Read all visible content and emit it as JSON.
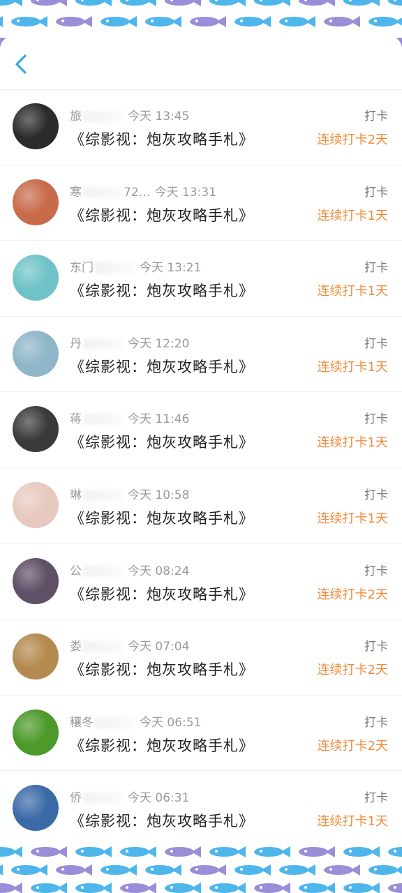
{
  "colors": {
    "accent_blue": "#3aa7e0",
    "streak_orange": "#f08a3a",
    "fish_blue": "#4fb6ec",
    "fish_purple": "#9b8ed8"
  },
  "header": {
    "back_icon": "chevron-left-icon"
  },
  "list": {
    "items": [
      {
        "user": "旅",
        "time": "今天 13:45",
        "book": "《综影视：炮灰攻略手札》",
        "action": "打卡",
        "streak": "连续打卡2天",
        "avatar_color": "#2b2b2b"
      },
      {
        "user": "寒",
        "time": "今天 13:31",
        "extra": "72…",
        "book": "《综影视：炮灰攻略手札》",
        "action": "打卡",
        "streak": "连续打卡1天",
        "avatar_color": "#c86b4b"
      },
      {
        "user": "东门",
        "time": "今天 13:21",
        "book": "《综影视：炮灰攻略手札》",
        "action": "打卡",
        "streak": "连续打卡1天",
        "avatar_color": "#6fc3c8"
      },
      {
        "user": "丹",
        "time": "今天 12:20",
        "book": "《综影视：炮灰攻略手札》",
        "action": "打卡",
        "streak": "连续打卡1天",
        "avatar_color": "#8fb6c9"
      },
      {
        "user": "蒋",
        "time": "今天 11:46",
        "book": "《综影视：炮灰攻略手札》",
        "action": "打卡",
        "streak": "连续打卡1天",
        "avatar_color": "#3a3a3a"
      },
      {
        "user": "琳",
        "time": "今天 10:58",
        "book": "《综影视：炮灰攻略手札》",
        "action": "打卡",
        "streak": "连续打卡1天",
        "avatar_color": "#e7c9c0"
      },
      {
        "user": "公",
        "time": "今天 08:24",
        "book": "《综影视：炮灰攻略手札》",
        "action": "打卡",
        "streak": "连续打卡2天",
        "avatar_color": "#5f4f67"
      },
      {
        "user": "娄",
        "time": "今天 07:04",
        "book": "《综影视：炮灰攻略手札》",
        "action": "打卡",
        "streak": "连续打卡2天",
        "avatar_color": "#b38a4f"
      },
      {
        "user": "穰冬",
        "time": "今天 06:51",
        "book": "《综影视：炮灰攻略手札》",
        "action": "打卡",
        "streak": "连续打卡2天",
        "avatar_color": "#4c9a2a"
      },
      {
        "user": "侨",
        "time": "今天 06:31",
        "book": "《综影视：炮灰攻略手札》",
        "action": "打卡",
        "streak": "连续打卡1天",
        "avatar_color": "#3b6aa8"
      }
    ]
  }
}
